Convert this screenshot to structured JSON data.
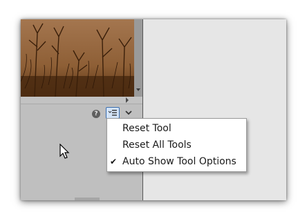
{
  "toolbar": {
    "help_symbol": "?",
    "tool_options_icon": "list-options-icon",
    "dropdown_icon": "chevron-down-icon"
  },
  "context_menu": {
    "items": [
      {
        "label": "Reset Tool",
        "checked": false
      },
      {
        "label": "Reset All Tools",
        "checked": false
      },
      {
        "label": "Auto Show Tool Options",
        "checked": true
      }
    ],
    "check_symbol": "✔"
  },
  "colors": {
    "panel_gray": "#bfbfbf",
    "right_area": "#e6e6e6",
    "button_highlight": "#d3e3f6",
    "button_border": "#3c6fb0"
  }
}
